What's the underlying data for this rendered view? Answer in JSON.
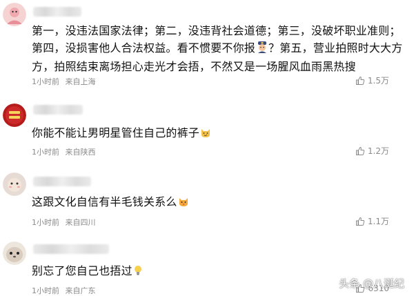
{
  "comments": [
    {
      "avatar_icon": "user-avatar-pink-icon",
      "text": "第一，没违法国家法律；第二，没违背社会道德；第三，没破坏职业准则；第四，没损害他人合法权益。看不惯要不你报",
      "emoji": "police-officer-emoji",
      "text_after": "？第五，营业拍照时大大方方，拍照结束离场担心走光才会捂，不然又是一场腥风血雨黑热搜",
      "time": "1小时前",
      "location": "来自上海",
      "likes": "1.5万"
    },
    {
      "avatar_icon": "user-avatar-red-icon",
      "text": "你能不能让男明星管住自己的裤子",
      "emoji": "smirking-cat-emoji",
      "time": "1小时前",
      "location": "来自陕西",
      "likes": "1.2万"
    },
    {
      "avatar_icon": "user-avatar-gray-icon",
      "text": "这跟文化自信有半毛钱关系么",
      "emoji": "cat-face-emoji",
      "time": "1小时前",
      "location": "来自四川",
      "likes": "1.1万"
    },
    {
      "avatar_icon": "user-avatar-seal-icon",
      "text": "别忘了您自己也捂过",
      "emoji": "lightbulb-emoji",
      "time": "1小时前",
      "location": "来自广东",
      "likes": "6310"
    }
  ],
  "watermark": {
    "text": "头条 @八诞纪"
  }
}
